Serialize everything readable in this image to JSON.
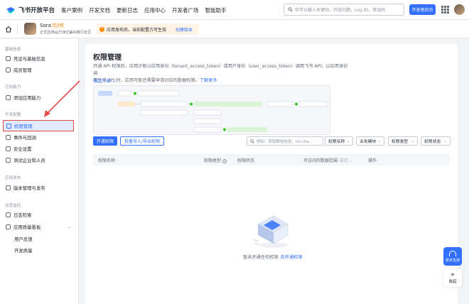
{
  "colors": {
    "accent": "#3370ff",
    "annotation": "#e34a4a",
    "warning": "#ff8800"
  },
  "topbar": {
    "brand": "飞书开放平台",
    "nav": [
      "客户案例",
      "开发文档",
      "更新日志",
      "应用中心",
      "开发者广场",
      "智能助手"
    ],
    "search_placeholder": "你可以输入关键词，开放问题，Log ID，错误码",
    "console_button": "开发者后台"
  },
  "app": {
    "name": "Sora2",
    "badge": "已上线",
    "desc": "正式应用@万洲亿赢AI旅行社区",
    "notice": "应用发布后，当前配置方可生效",
    "notice_link": "创建版本"
  },
  "sidebar": {
    "groups": [
      {
        "label": "基础信息",
        "items": [
          {
            "label": "凭证与基础信息",
            "icon": "credential-icon"
          },
          {
            "label": "成员管理",
            "icon": "members-icon"
          }
        ]
      },
      {
        "label": "应用能力",
        "items": [
          {
            "label": "添加应用能力",
            "icon": "add-capability-icon"
          }
        ]
      },
      {
        "label": "开发配置",
        "items": [
          {
            "label": "权限管理",
            "icon": "permission-icon",
            "active": true
          },
          {
            "label": "事件与回调",
            "icon": "event-icon"
          },
          {
            "label": "安全设置",
            "icon": "security-icon"
          },
          {
            "label": "测试企业和人员",
            "icon": "test-icon"
          }
        ]
      },
      {
        "label": "应用发布",
        "items": [
          {
            "label": "版本管理与发布",
            "icon": "version-icon"
          }
        ]
      },
      {
        "label": "运营监控",
        "items": [
          {
            "label": "日志检索",
            "icon": "log-icon"
          },
          {
            "label": "应用质量看板",
            "icon": "quality-icon"
          }
        ],
        "subitems": [
          "用户反馈",
          "开发质量"
        ]
      }
    ]
  },
  "main": {
    "title": "权限管理",
    "desc_line1": "开通 API 权限后，应用才能以应用身份（tenant_access_token）或用户身份（user_access_token）调用飞书 API；以应用身份调",
    "desc_line2": "用飞书 API 时，应用可能还需要申请对应的数据权限。",
    "desc_link": "了解更多",
    "collapse": "收起介绍",
    "diagram_labels": [
      "",
      "",
      "",
      "",
      "",
      "",
      "",
      "",
      "",
      ""
    ],
    "btn_enable": "开通权限",
    "btn_batch": "批量导入/导出权限",
    "search_placeholder": "例如：获取群组信息、im:cha...",
    "filters": [
      "权限名称",
      "业务模块",
      "权限类型",
      "权限状态"
    ],
    "columns": [
      "权限名称",
      "权限类型",
      "权限状态",
      "可访问的数据范围",
      "前往",
      "操作"
    ],
    "empty_text": "暂未开通任何权限",
    "empty_link": "去开通权限"
  },
  "fab": {
    "support": "技术支持",
    "collapse": "收起"
  }
}
